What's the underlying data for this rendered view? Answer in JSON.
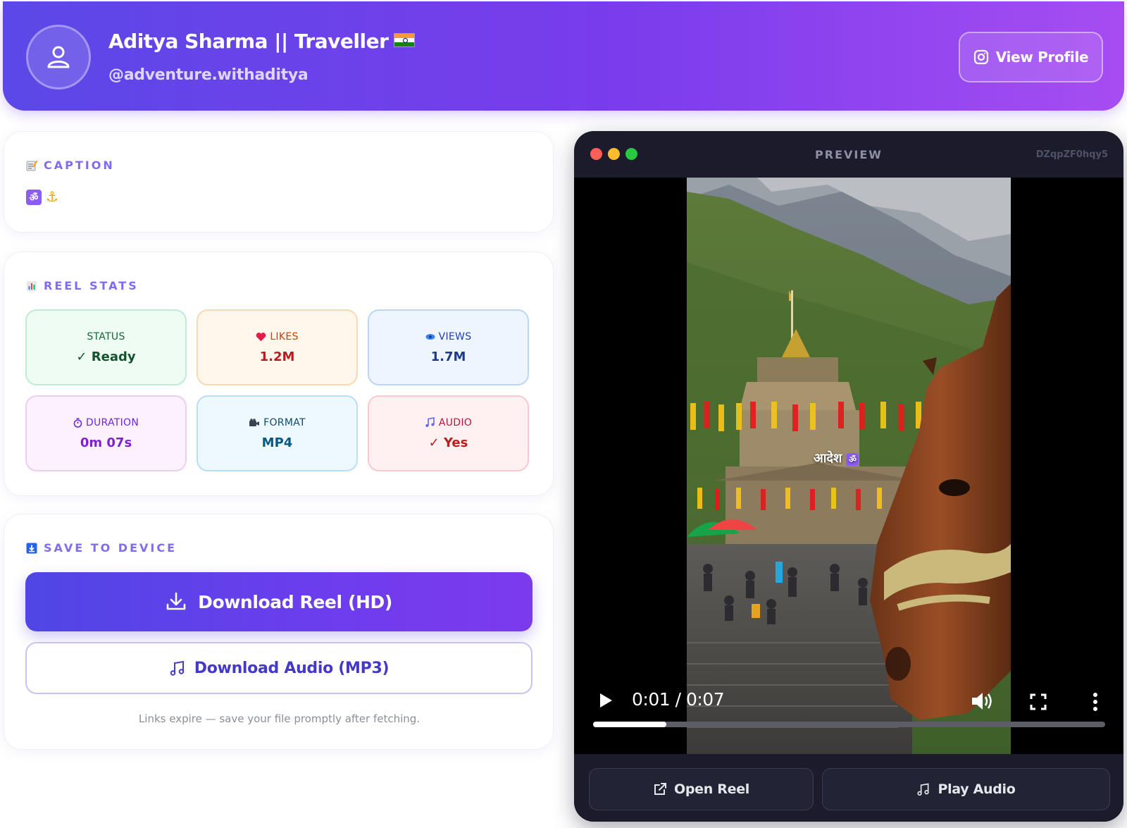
{
  "header": {
    "name": "Aditya Sharma || Traveller",
    "handle": "@adventure.withaditya",
    "view_profile_label": "View Profile"
  },
  "caption": {
    "title": "CAPTION",
    "symbols": [
      "ॐ",
      "⚓"
    ]
  },
  "stats": {
    "title": "REEL STATS",
    "items": [
      {
        "label": "STATUS",
        "value": "✓ Ready",
        "icon": "none"
      },
      {
        "label": "LIKES",
        "value": "1.2M",
        "icon": "heart-icon"
      },
      {
        "label": "VIEWS",
        "value": "1.7M",
        "icon": "eye-icon"
      },
      {
        "label": "DURATION",
        "value": "0m 07s",
        "icon": "timer-icon"
      },
      {
        "label": "FORMAT",
        "value": "MP4",
        "icon": "video-camera-icon"
      },
      {
        "label": "AUDIO",
        "value": "✓ Yes",
        "icon": "music-note-icon"
      }
    ]
  },
  "save": {
    "title": "SAVE TO DEVICE",
    "download_reel_label": "Download Reel (HD)",
    "download_audio_label": "Download Audio (MP3)",
    "note": "Links expire — save your file promptly after fetching."
  },
  "preview": {
    "title": "PREVIEW",
    "reel_id": "DZqpZF0hqy5",
    "overlay_text": "आदेश",
    "time": "0:01 / 0:07",
    "progress_fraction": 0.143,
    "open_reel_label": "Open Reel",
    "play_audio_label": "Play Audio"
  },
  "colors": {
    "accent": "#7c3aed",
    "header_start": "#5b48e6",
    "header_end": "#a64df2"
  }
}
